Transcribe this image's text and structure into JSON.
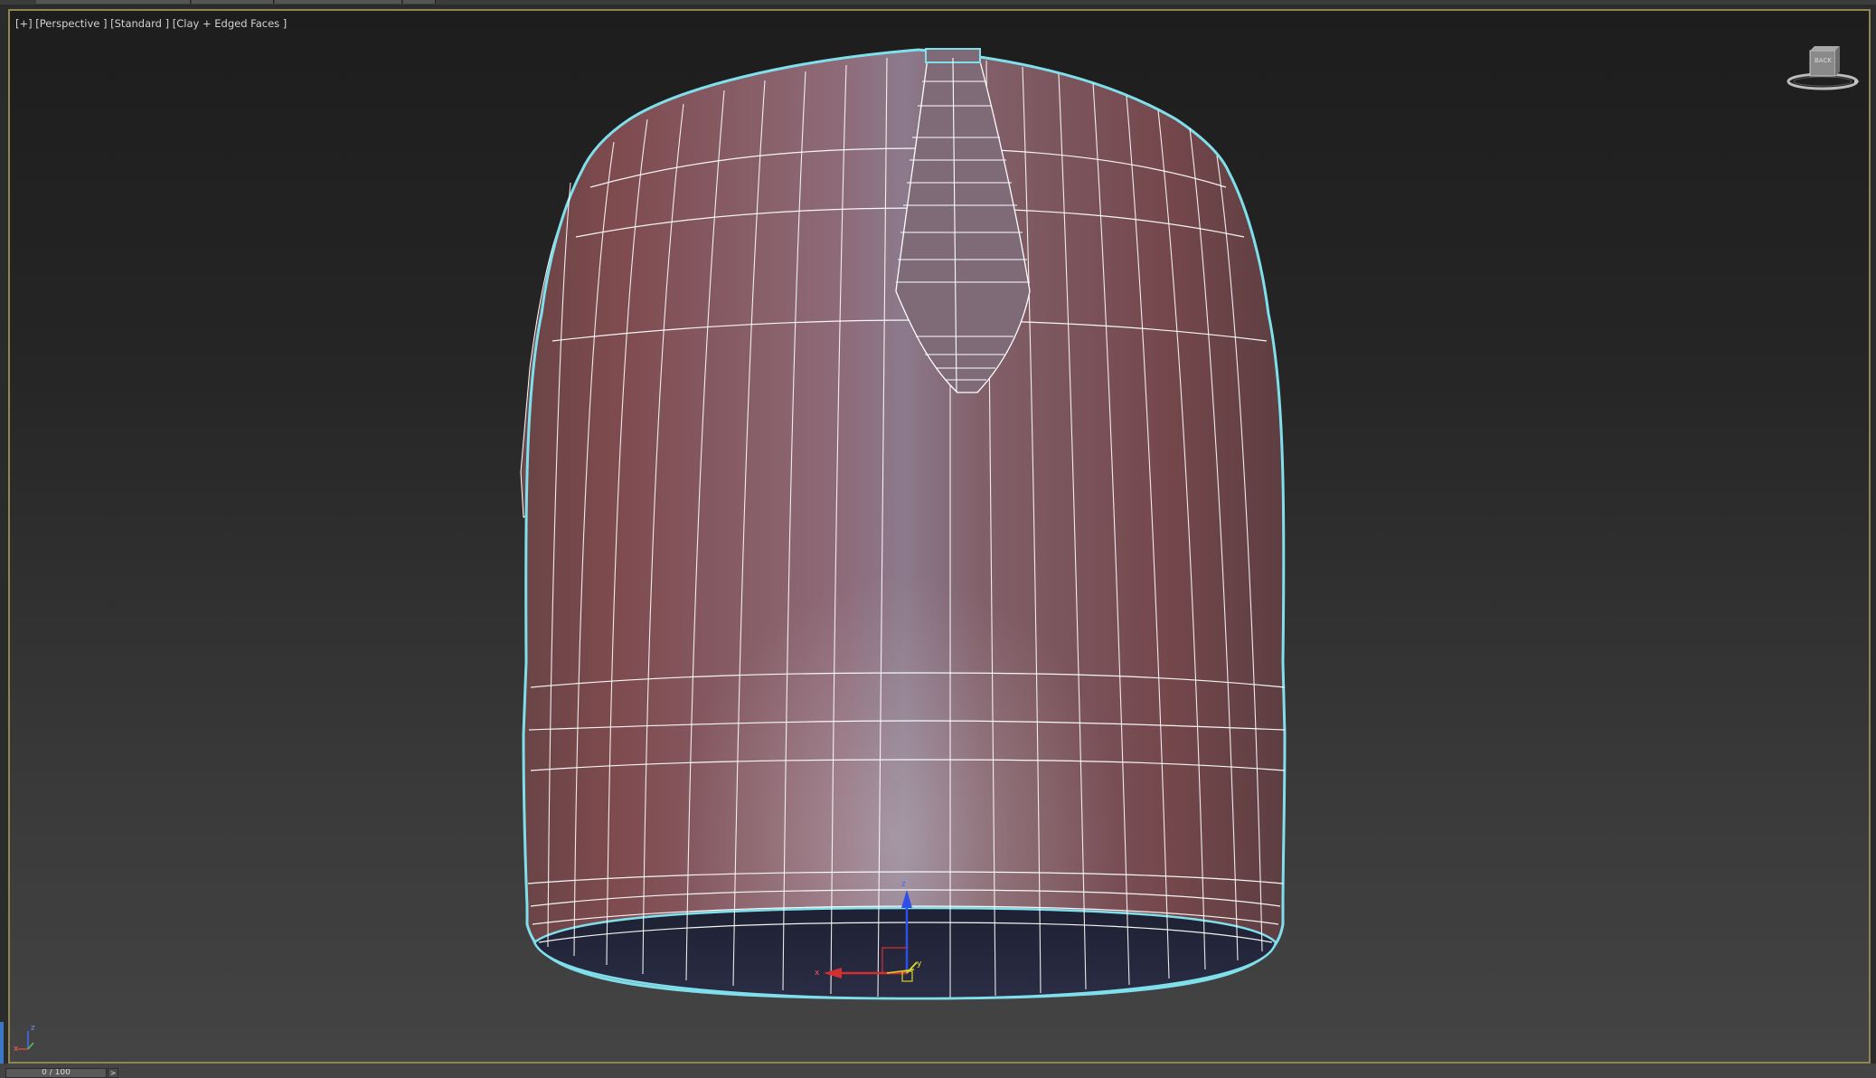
{
  "viewport": {
    "label": "[+] [Perspective ] [Standard ] [Clay + Edged Faces ]",
    "viewcube_label": "BACK",
    "colors": {
      "frame": "#8f8553",
      "mesh_wire": "#ffffff",
      "selection_outline": "#7fe0ec",
      "clay": "#7a4f53",
      "bottom_cap": "#23263a"
    }
  },
  "gizmo": {
    "x_label": "x",
    "y_label": "y",
    "z_label": "z"
  },
  "axis_tripod": {
    "x_label": "x",
    "z_label": "z"
  },
  "timeline": {
    "slider_text": "0 / 100",
    "next_button": ">"
  }
}
